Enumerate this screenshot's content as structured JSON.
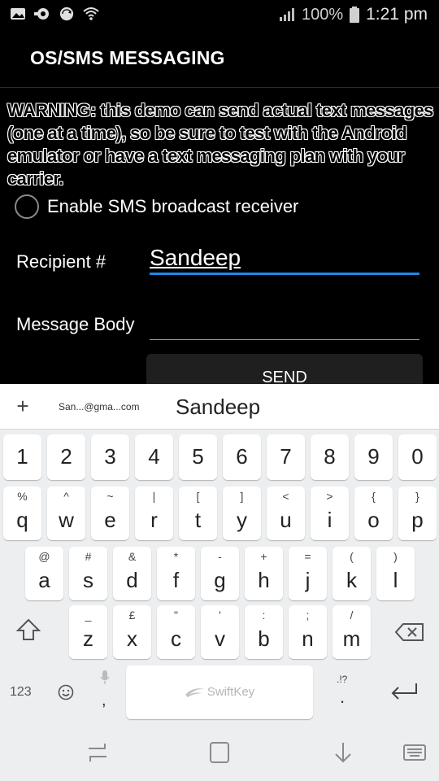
{
  "status_bar": {
    "battery_pct": "100%",
    "time": "1:21 pm",
    "left_icons": [
      "gallery-icon",
      "ring-icon",
      "sync-icon",
      "wifi-icon"
    ]
  },
  "app_bar": {
    "title": "OS/SMS MESSAGING"
  },
  "content": {
    "warning": "WARNING: this demo can send actual text messages (one at a time), so be sure to test with the Android emulator or have a text messaging plan with your carrier.",
    "radio_label": "Enable SMS broadcast receiver",
    "recipient_label": "Recipient #",
    "recipient_value": "Sandeep",
    "message_label": "Message Body",
    "message_value": "",
    "send_label": "SEND"
  },
  "keyboard": {
    "plus": "+",
    "suggestion_small": "San...@gma...com",
    "suggestion_main": "Sandeep",
    "row_numbers": [
      "1",
      "2",
      "3",
      "4",
      "5",
      "6",
      "7",
      "8",
      "9",
      "0"
    ],
    "row1": [
      [
        "%",
        "q"
      ],
      [
        "^",
        "w"
      ],
      [
        "~",
        "e"
      ],
      [
        "|",
        "r"
      ],
      [
        "[",
        "t"
      ],
      [
        "]",
        "y"
      ],
      [
        "<",
        "u"
      ],
      [
        ">",
        "i"
      ],
      [
        "{",
        "o"
      ],
      [
        "}",
        "p"
      ]
    ],
    "row2": [
      [
        "@",
        "a"
      ],
      [
        "#",
        "s"
      ],
      [
        "&",
        "d"
      ],
      [
        "*",
        "f"
      ],
      [
        "-",
        "g"
      ],
      [
        "+",
        "h"
      ],
      [
        "=",
        "j"
      ],
      [
        "(",
        "k"
      ],
      [
        ")",
        "l"
      ]
    ],
    "row3": [
      [
        "_",
        "z"
      ],
      [
        "£",
        "x"
      ],
      [
        "\"",
        "c"
      ],
      [
        "'",
        "v"
      ],
      [
        ":",
        "b"
      ],
      [
        ";",
        "n"
      ],
      [
        "/",
        "m"
      ]
    ],
    "key_123": "123",
    "comma": ",",
    "period": ".",
    "punct_hint": ".!?",
    "space_label": "SwiftKey"
  },
  "colors": {
    "accent": "#1e88e5",
    "keyboard_bg": "#eceef0"
  }
}
